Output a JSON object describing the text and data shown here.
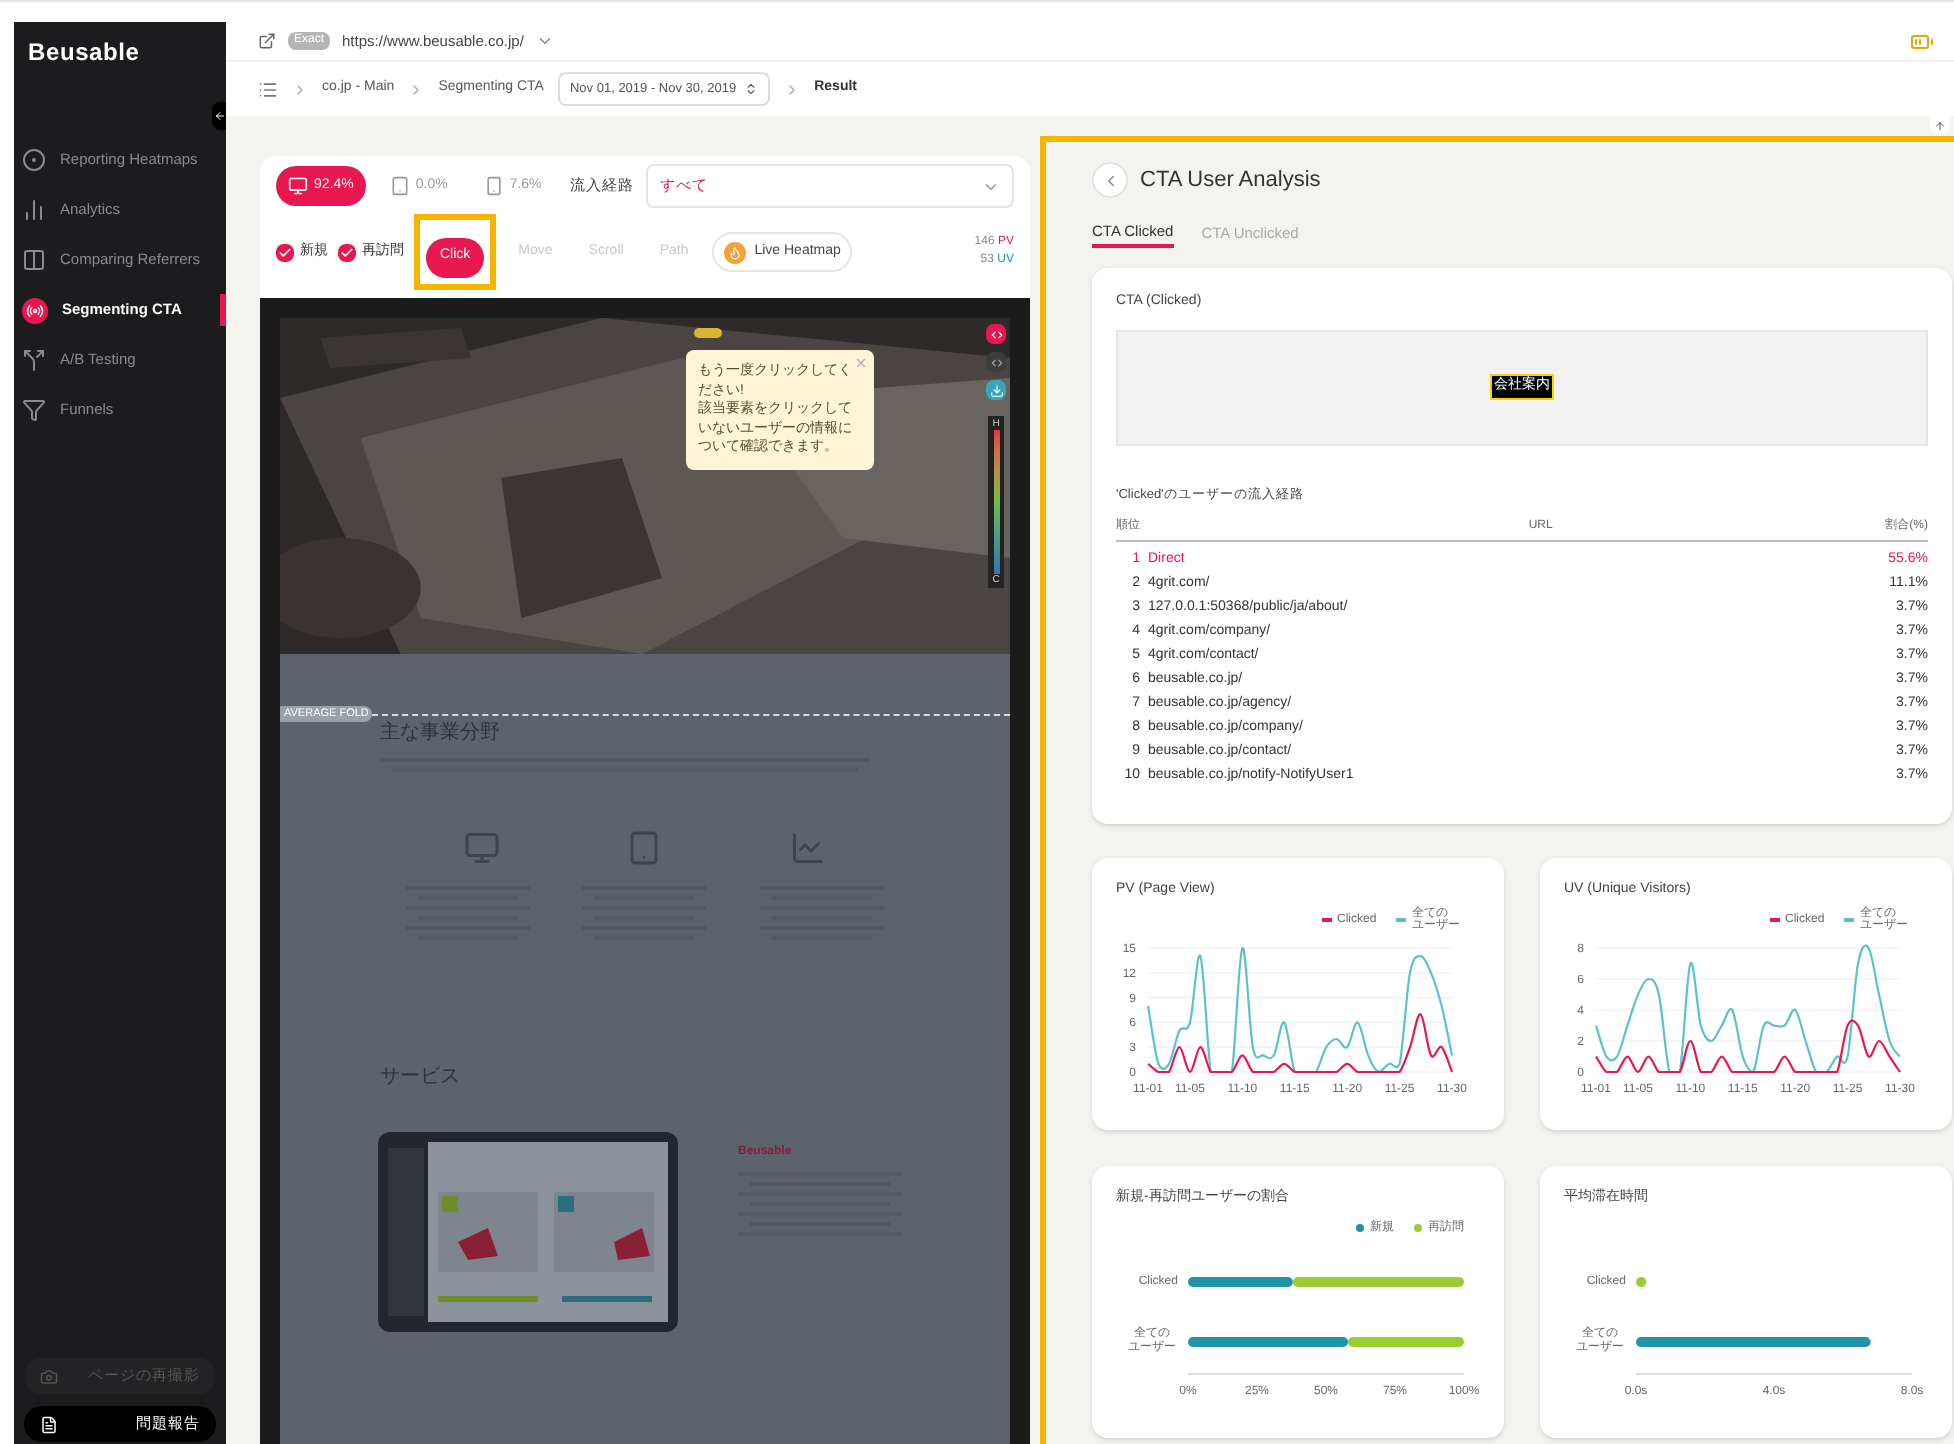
{
  "app": {
    "logo": "Beusable"
  },
  "sidebar": {
    "items": [
      {
        "label": "Reporting Heatmaps",
        "selected": false
      },
      {
        "label": "Analytics",
        "selected": false
      },
      {
        "label": "Comparing Referrers",
        "selected": false
      },
      {
        "label": "Segmenting CTA",
        "selected": true
      },
      {
        "label": "A/B Testing",
        "selected": false
      },
      {
        "label": "Funnels",
        "selected": false
      }
    ],
    "footer_buttons": [
      {
        "label": "ページの再撮影",
        "disabled": true
      },
      {
        "label": "問題報告",
        "disabled": false
      }
    ]
  },
  "url_bar": {
    "match": "Exact",
    "url": "https://www.beusable.co.jp/"
  },
  "breadcrumb": {
    "items": [
      "co.jp - Main",
      "Segmenting CTA"
    ],
    "date_range": "Nov 01, 2019 - Nov 30, 2019",
    "current": "Result"
  },
  "devices": [
    {
      "share": "92.4%",
      "selected": true
    },
    {
      "share": "0.0%",
      "selected": false
    },
    {
      "share": "7.6%",
      "selected": false
    }
  ],
  "source_filter": {
    "label": "流入経路",
    "value": "すべて"
  },
  "visitor_filters": [
    {
      "label": "新規",
      "checked": true
    },
    {
      "label": "再訪問",
      "checked": true
    }
  ],
  "modes": [
    {
      "label": "Click",
      "selected": true
    },
    {
      "label": "Move",
      "selected": false
    },
    {
      "label": "Scroll",
      "selected": false
    },
    {
      "label": "Path",
      "selected": false
    }
  ],
  "live_button": "Live Heatmap",
  "counts": [
    {
      "value": "146",
      "unit": "PV",
      "color": "#e8174f"
    },
    {
      "value": "53",
      "unit": "UV",
      "color": "#1f93a8"
    }
  ],
  "heatmap": {
    "tooltip": [
      "もう一度クリックしてください!",
      "該当要素をクリックしていないユーザーの情報について確認できます。"
    ],
    "scale": {
      "high": "H",
      "low": "C"
    },
    "fold_label": "AVERAGE FOLD",
    "sections": [
      "主な事業分野",
      "サービス"
    ],
    "brand": "Beusable"
  },
  "analysis": {
    "title": "CTA User Analysis",
    "tabs": [
      {
        "label": "CTA Clicked",
        "selected": true
      },
      {
        "label": "CTA Unclicked",
        "selected": false
      }
    ],
    "cta_card": {
      "title": "CTA (Clicked)",
      "element_label": "会社案内",
      "table_title": "'Clicked'のユーザーの流入経路",
      "columns": [
        "順位",
        "URL",
        "割合(%)"
      ],
      "rows": [
        {
          "rank": "1",
          "url": "Direct",
          "share": "55.6%",
          "highlighted": true
        },
        {
          "rank": "2",
          "url": "4grit.com/",
          "share": "11.1%",
          "highlighted": false
        },
        {
          "rank": "3",
          "url": "127.0.0.1:50368/public/ja/about/",
          "share": "3.7%",
          "highlighted": false
        },
        {
          "rank": "4",
          "url": "4grit.com/company/",
          "share": "3.7%",
          "highlighted": false
        },
        {
          "rank": "5",
          "url": "4grit.com/contact/",
          "share": "3.7%",
          "highlighted": false
        },
        {
          "rank": "6",
          "url": "beusable.co.jp/",
          "share": "3.7%",
          "highlighted": false
        },
        {
          "rank": "7",
          "url": "beusable.co.jp/agency/",
          "share": "3.7%",
          "highlighted": false
        },
        {
          "rank": "8",
          "url": "beusable.co.jp/company/",
          "share": "3.7%",
          "highlighted": false
        },
        {
          "rank": "9",
          "url": "beusable.co.jp/contact/",
          "share": "3.7%",
          "highlighted": false
        },
        {
          "rank": "10",
          "url": "beusable.co.jp/notify-NotifyUser1",
          "share": "3.7%",
          "highlighted": false
        }
      ]
    },
    "charts": [
      {
        "title": "PV (Page View)",
        "chart_data": {
          "type": "line",
          "legend": "top-right",
          "grid": true,
          "categories": [
            "11-01",
            null,
            null,
            null,
            "11-05",
            null,
            null,
            null,
            null,
            "11-10",
            null,
            null,
            null,
            null,
            "11-15",
            null,
            null,
            null,
            null,
            "11-20",
            null,
            null,
            null,
            null,
            "11-25",
            null,
            null,
            null,
            null,
            "11-30"
          ],
          "series": [
            {
              "name": "Clicked",
              "color": "#e8174f",
              "values": [
                1,
                0,
                0,
                3,
                0,
                3,
                0,
                0,
                0,
                2,
                0,
                0,
                0,
                1,
                0,
                0,
                0,
                0,
                0,
                1,
                0,
                0,
                0,
                0,
                0,
                3,
                7,
                2,
                3,
                0
              ]
            },
            {
              "name": "全てのユーザー",
              "color": "#5bc0cf",
              "values": [
                8,
                1,
                1,
                5,
                6,
                14,
                0,
                0,
                0,
                15,
                3,
                2,
                2,
                6,
                0,
                0,
                0,
                3,
                4,
                3,
                6,
                2,
                0,
                1,
                1,
                12,
                14,
                12,
                8,
                2
              ]
            }
          ],
          "yticks": [
            0,
            3,
            6,
            9,
            12,
            15
          ],
          "ylim": [
            0,
            15
          ]
        }
      },
      {
        "title": "UV (Unique Visitors)",
        "chart_data": {
          "type": "line",
          "legend": "top-right",
          "grid": true,
          "categories": [
            "11-01",
            null,
            null,
            null,
            "11-05",
            null,
            null,
            null,
            null,
            "11-10",
            null,
            null,
            null,
            null,
            "11-15",
            null,
            null,
            null,
            null,
            "11-20",
            null,
            null,
            null,
            null,
            "11-25",
            null,
            null,
            null,
            null,
            "11-30"
          ],
          "series": [
            {
              "name": "Clicked",
              "color": "#e8174f",
              "values": [
                1,
                0,
                0,
                1,
                0,
                1,
                0,
                0,
                0,
                2,
                0,
                0,
                1,
                0,
                0,
                0,
                0,
                0,
                1,
                0,
                0,
                0,
                0,
                0,
                3,
                3,
                1,
                2,
                1,
                0
              ]
            },
            {
              "name": "全てのユーザー",
              "color": "#5bc0cf",
              "values": [
                3,
                1,
                1,
                3,
                5,
                6,
                5,
                0,
                0,
                7,
                3,
                2,
                3,
                4,
                1,
                0,
                3,
                3,
                3,
                4,
                2,
                0,
                0,
                1,
                1,
                7,
                8,
                5,
                2,
                1
              ]
            }
          ],
          "yticks": [
            0,
            2,
            4,
            6,
            8
          ],
          "ylim": [
            0,
            8
          ]
        }
      },
      {
        "title": "新規-再訪問ユーザーの割合",
        "chart_data": {
          "type": "bar",
          "orientation": "horizontal",
          "stacked": true,
          "legend": "top-right",
          "categories": [
            "Clicked",
            "全てのユーザー"
          ],
          "series": [
            {
              "name": "新規",
              "color": "#1f93a8",
              "values": [
                38,
                58
              ]
            },
            {
              "name": "再訪問",
              "color": "#9acd32",
              "values": [
                62,
                42
              ]
            }
          ],
          "xlim": [
            0,
            100
          ],
          "xticks": [
            {
              "value": 0,
              "label": "0%"
            },
            {
              "value": 25,
              "label": "25%"
            },
            {
              "value": 50,
              "label": "50%"
            },
            {
              "value": 75,
              "label": "75%"
            },
            {
              "value": 100,
              "label": "100%"
            }
          ]
        }
      },
      {
        "title": "平均滞在時間",
        "chart_data": {
          "type": "bar",
          "orientation": "horizontal",
          "stacked": true,
          "categories": [
            "Clicked",
            "全てのユーザー"
          ],
          "series": [
            {
              "color": "#9acd32",
              "values": [
                0.3,
                null
              ]
            },
            {
              "color": "#1f93a8",
              "values": [
                null,
                6.8
              ]
            }
          ],
          "xlim": [
            0,
            8
          ],
          "xticks": [
            {
              "value": 0,
              "label": "0.0s"
            },
            {
              "value": 4,
              "label": "4.0s"
            },
            {
              "value": 8,
              "label": "8.0s"
            }
          ]
        }
      }
    ]
  }
}
